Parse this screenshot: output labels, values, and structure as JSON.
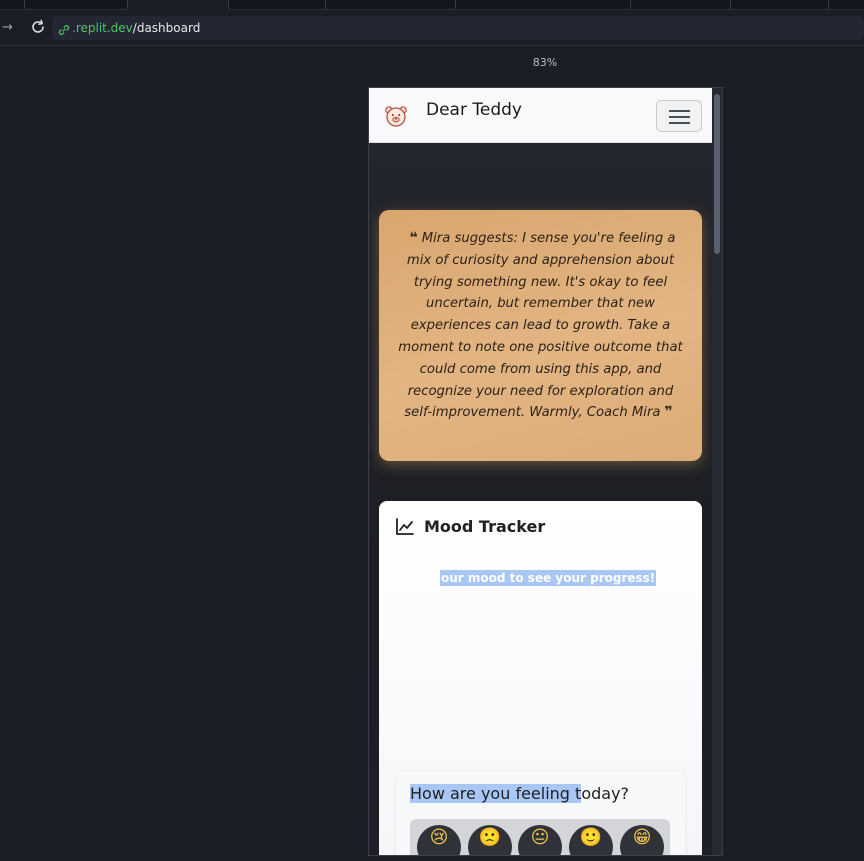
{
  "browser": {
    "url_domain": ".replit.dev",
    "url_path": "/dashboard",
    "zoom": "83%"
  },
  "app": {
    "brand": "Dear Teddy"
  },
  "quote": {
    "open_mark": "❝",
    "text": "Mira suggests: I sense you're feeling a mix of curiosity and apprehension about trying something new. It's okay to feel uncertain, but remember that new experiences can lead to growth. Take a moment to note one positive outcome that could come from using this app, and recognize your need for exploration and self-improvement. Warmly, Coach Mira",
    "close_mark": "❞"
  },
  "mood_tracker": {
    "title": "Mood Tracker",
    "empty_message": "our mood to see your progress!",
    "feeling": {
      "title_selected": "How are you feeling t",
      "title_rest": "oday?",
      "emojis": [
        {
          "glyph": "😢",
          "label": "very sad"
        },
        {
          "glyph": "🙁",
          "label": "sad"
        },
        {
          "glyph": "😐",
          "label": "neutral"
        },
        {
          "glyph": "🙂",
          "label": "happy"
        },
        {
          "glyph": "😁",
          "label": "very happy"
        }
      ]
    }
  },
  "colors": {
    "quote_card": "#e2b583",
    "selection_highlight": "#a9c7f5",
    "url_domain": "#4ec46a"
  }
}
